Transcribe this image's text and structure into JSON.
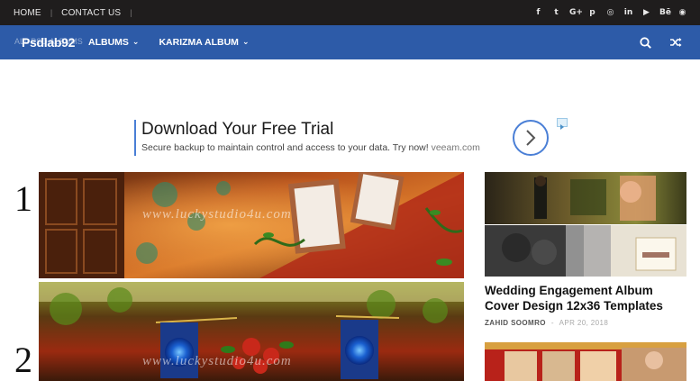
{
  "topbar": {
    "links": [
      "HOME",
      "CONTACT US"
    ],
    "social_icons": [
      "facebook-icon",
      "twitter-icon",
      "google-plus-icon",
      "pinterest-icon",
      "instagram-icon",
      "linkedin-icon",
      "youtube-icon",
      "behance-icon",
      "rss-icon"
    ],
    "social_glyphs": [
      "f",
      "t",
      "G+",
      "p",
      "◎",
      "in",
      "▶",
      "Bē",
      "◉"
    ]
  },
  "navbar": {
    "logo": "Psdlab92",
    "ghost_text": "ALL PSD ALBUMS",
    "menu": [
      {
        "label": "ALBUMS"
      },
      {
        "label": "KARIZMA ALBUM"
      }
    ],
    "chevron": "⌄",
    "bg_color": "#2d5ba8"
  },
  "ad": {
    "headline": "Download Your Free Trial",
    "description": "Secure backup to maintain control and access to your data. Try now!",
    "url": "veeam.com"
  },
  "main": {
    "numbers": [
      "1",
      "2"
    ],
    "watermark": "www.luckystudio4u.com"
  },
  "sidebar": {
    "post_title": "Wedding Engagement Album Cover Design 12x36 Templates",
    "author": "ZAHID SOOMRO",
    "separator": "-",
    "date": "APR 20, 2018"
  }
}
